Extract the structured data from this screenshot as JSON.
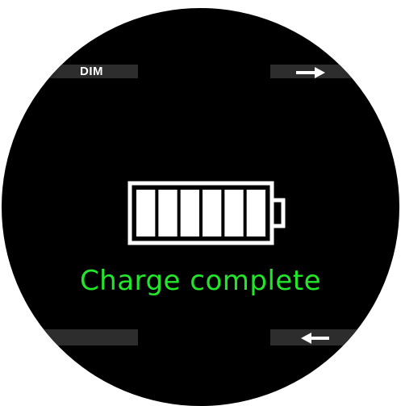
{
  "device": {
    "top_left_key_label": "DIM",
    "top_right_key_icon": "arrow-right-icon",
    "bottom_right_key_icon": "arrow-left-icon",
    "battery_icon": "battery-full-icon",
    "battery_level": 1.0,
    "battery_segments": 6,
    "status_text": "Charge complete",
    "status_color": "#22e62a",
    "screen_color": "#000000"
  }
}
